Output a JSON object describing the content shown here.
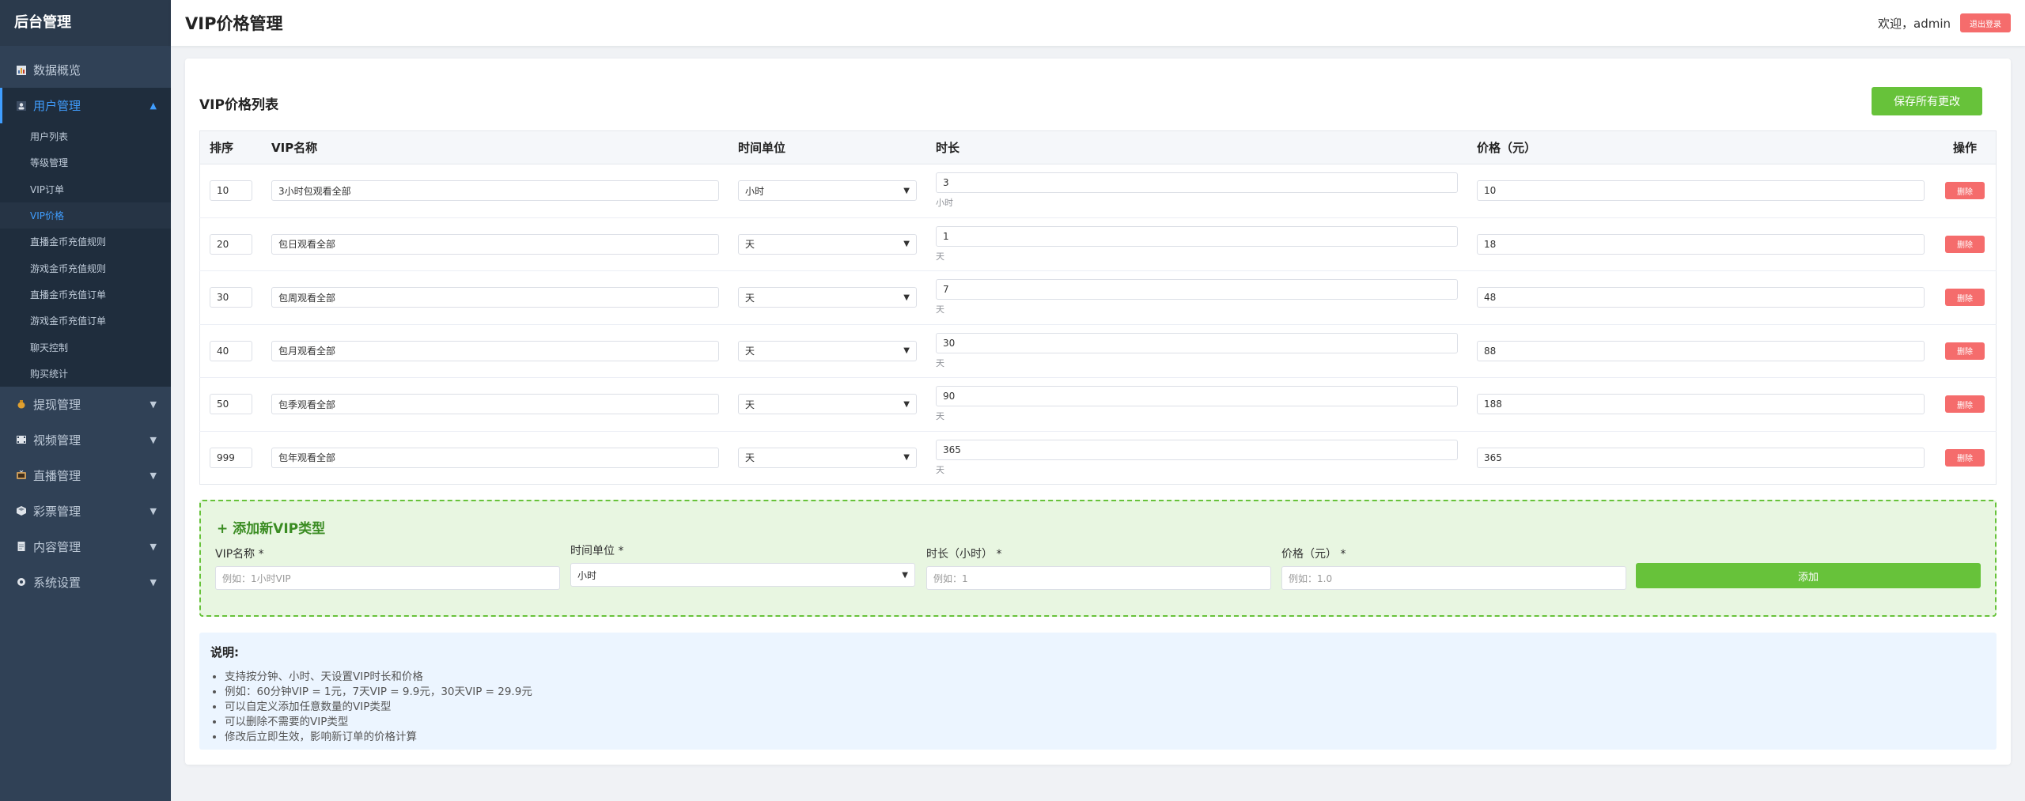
{
  "sidebar": {
    "brand": "后台管理",
    "items": [
      {
        "label": "数据概览",
        "icon": "chart-icon"
      },
      {
        "label": "用户管理",
        "icon": "user-icon",
        "active": true
      },
      {
        "label": "提现管理",
        "icon": "money-bag-icon"
      },
      {
        "label": "视频管理",
        "icon": "film-icon"
      },
      {
        "label": "直播管理",
        "icon": "tv-icon"
      },
      {
        "label": "彩票管理",
        "icon": "ticket-icon"
      },
      {
        "label": "内容管理",
        "icon": "document-icon"
      },
      {
        "label": "系统设置",
        "icon": "gear-icon"
      }
    ],
    "user_sub": [
      "用户列表",
      "等级管理",
      "VIP订单",
      "VIP价格",
      "直播金币充值规则",
      "游戏金币充值规则",
      "直播金币充值订单",
      "游戏金币充值订单",
      "聊天控制",
      "购买统计"
    ]
  },
  "header": {
    "title": "VIP价格管理",
    "welcome": "欢迎，admin",
    "logout": "退出登录"
  },
  "list": {
    "title": "VIP价格列表",
    "save_all": "保存所有更改",
    "columns": {
      "sort": "排序",
      "name": "VIP名称",
      "unit": "时间单位",
      "duration": "时长",
      "price": "价格（元）",
      "ops": "操作"
    },
    "delete_label": "删除",
    "rows": [
      {
        "sort": "10",
        "name": "3小时包观看全部",
        "unit": "小时",
        "duration": "3",
        "hint": "小时",
        "price": "10"
      },
      {
        "sort": "20",
        "name": "包日观看全部",
        "unit": "天",
        "duration": "1",
        "hint": "天",
        "price": "18"
      },
      {
        "sort": "30",
        "name": "包周观看全部",
        "unit": "天",
        "duration": "7",
        "hint": "天",
        "price": "48"
      },
      {
        "sort": "40",
        "name": "包月观看全部",
        "unit": "天",
        "duration": "30",
        "hint": "天",
        "price": "88"
      },
      {
        "sort": "50",
        "name": "包季观看全部",
        "unit": "天",
        "duration": "90",
        "hint": "天",
        "price": "188"
      },
      {
        "sort": "999",
        "name": "包年观看全部",
        "unit": "天",
        "duration": "365",
        "hint": "天",
        "price": "365"
      }
    ]
  },
  "add": {
    "title": "+ 添加新VIP类型",
    "name_label": "VIP名称 *",
    "name_placeholder": "例如：1小时VIP",
    "unit_label": "时间单位 *",
    "unit_value": "小时",
    "duration_label": "时长（小时） *",
    "duration_placeholder": "例如：1",
    "price_label": "价格（元） *",
    "price_placeholder": "例如：1.0",
    "add_button": "添加"
  },
  "notes": {
    "title": "说明:",
    "items": [
      "支持按分钟、小时、天设置VIP时长和价格",
      "例如：60分钟VIP = 1元，7天VIP = 9.9元，30天VIP = 29.9元",
      "可以自定义添加任意数量的VIP类型",
      "可以删除不需要的VIP类型",
      "修改后立即生效，影响新订单的价格计算"
    ]
  },
  "colors": {
    "sidebar_bg": "#304156",
    "accent": "#409eff",
    "success": "#67c23a",
    "danger": "#f56c6c"
  }
}
